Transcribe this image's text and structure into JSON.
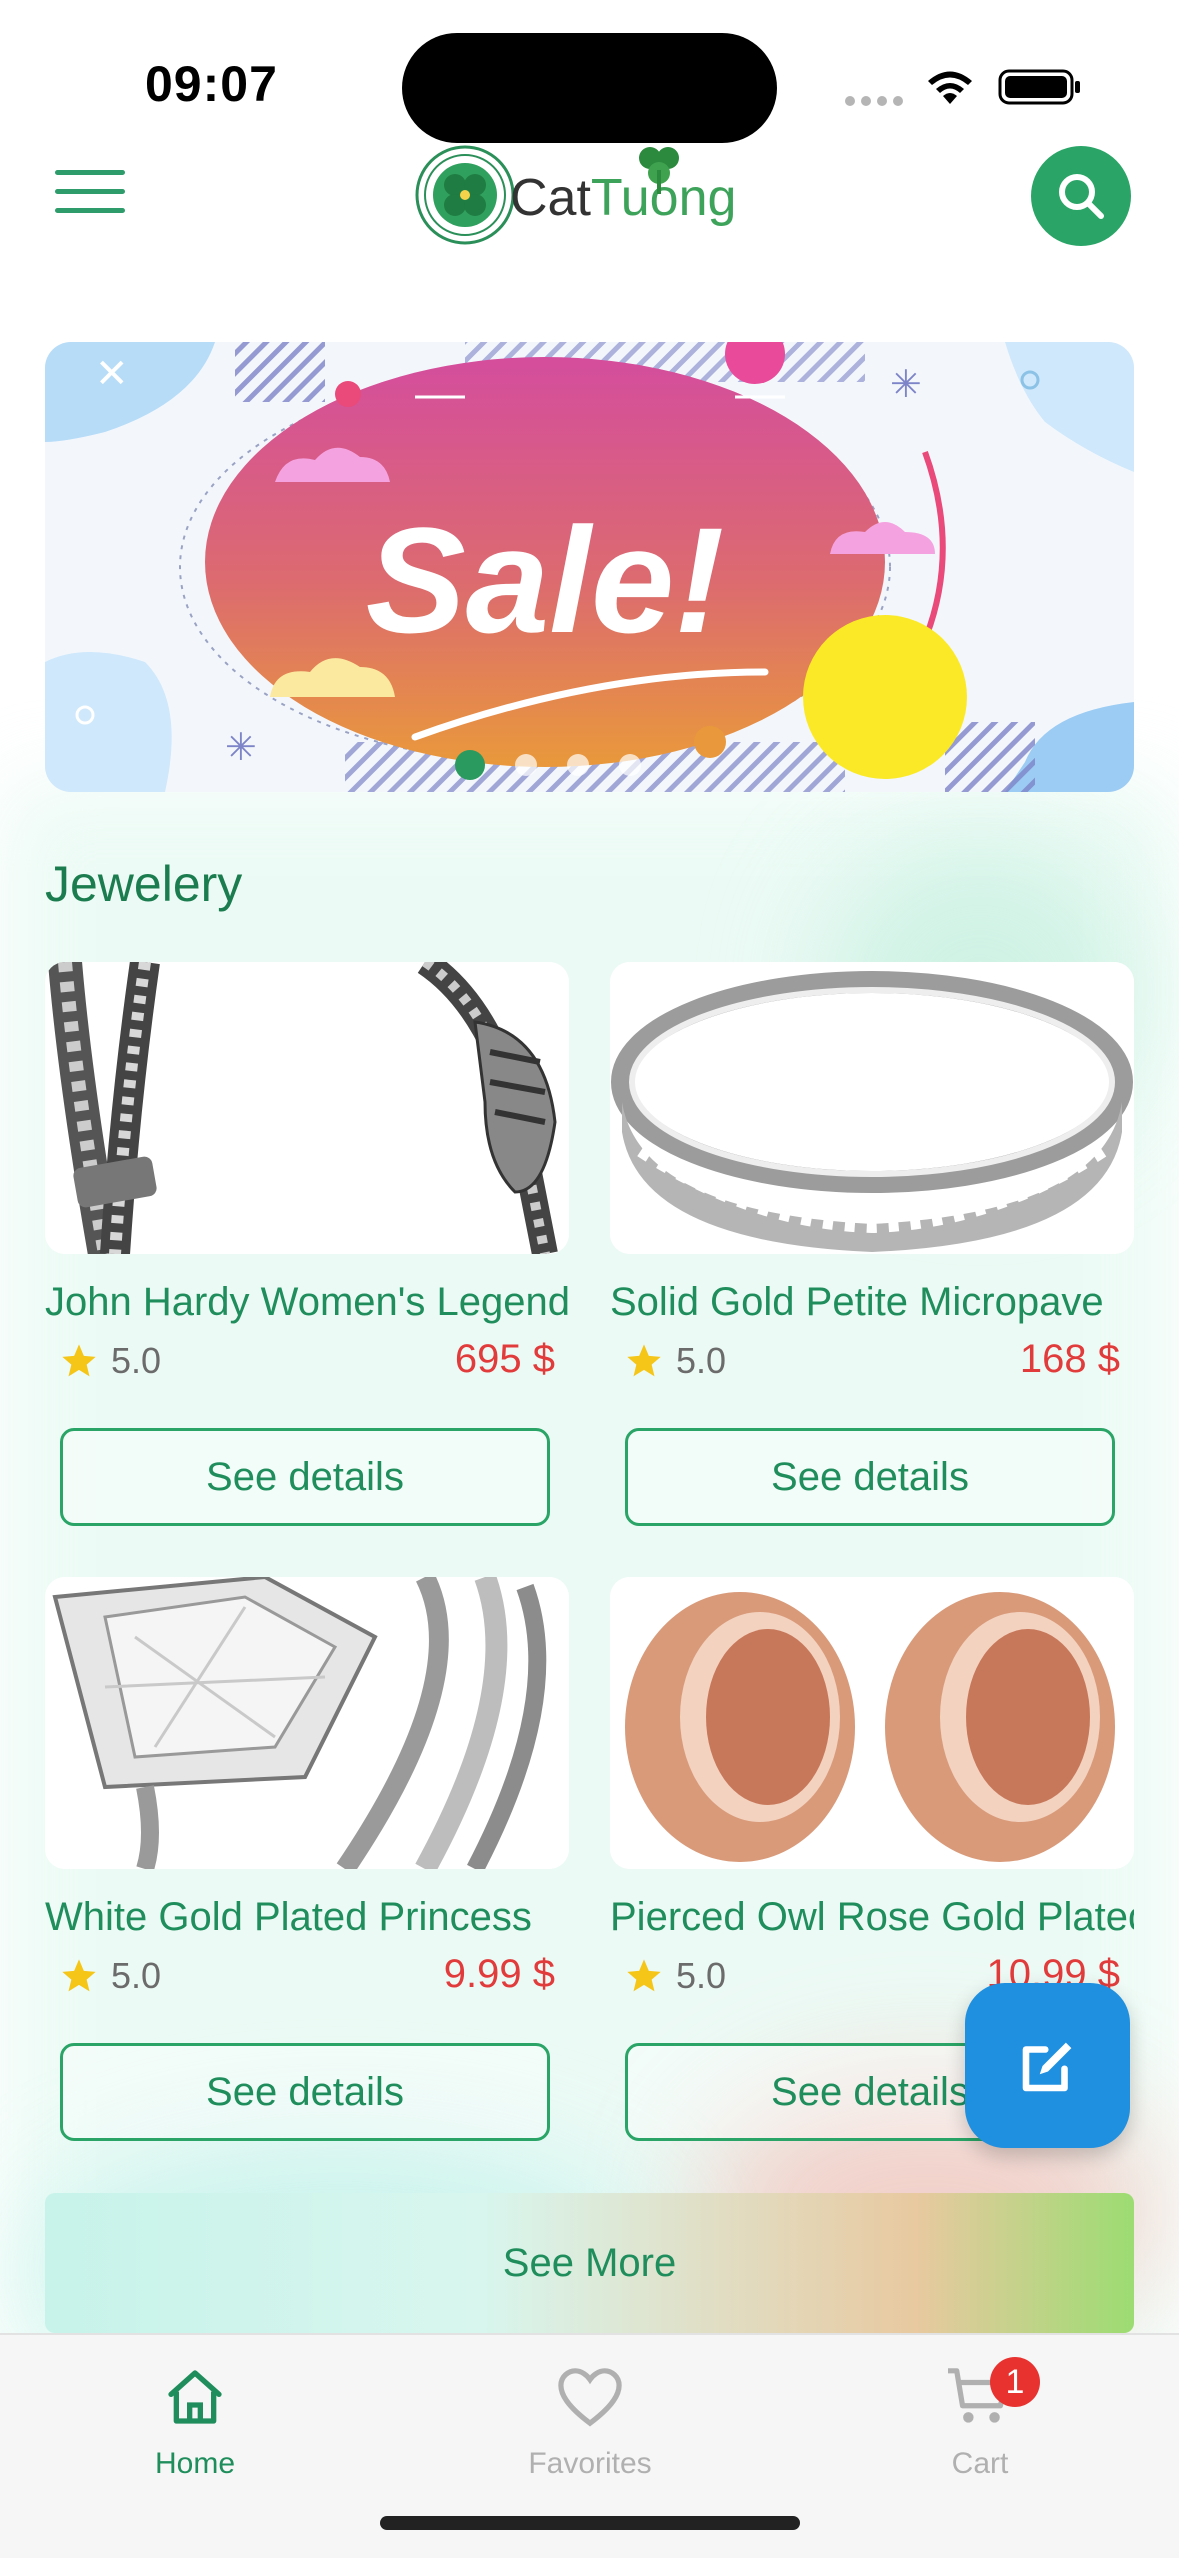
{
  "status_bar": {
    "time": "09:07"
  },
  "header": {
    "logo_text_1": "Cat",
    "logo_text_2": "Tuong"
  },
  "banner": {
    "headline": "Sale!",
    "pages": 5,
    "active_page": 1
  },
  "section": {
    "title": "Jewelery"
  },
  "products": [
    {
      "name": "John Hardy Women's Legends Naga",
      "rating": "5.0",
      "price": "695 $",
      "button": "See details"
    },
    {
      "name": "Solid Gold Petite Micropave",
      "rating": "5.0",
      "price": "168 $",
      "button": "See details"
    },
    {
      "name": "White Gold Plated Princess",
      "rating": "5.0",
      "price": "9.99 $",
      "button": "See details"
    },
    {
      "name": "Pierced Owl Rose Gold Plated",
      "rating": "5.0",
      "price": "10.99 $",
      "button": "See details"
    }
  ],
  "see_more": {
    "label": "See More"
  },
  "tabbar": {
    "home": "Home",
    "favorites": "Favorites",
    "cart": "Cart",
    "cart_badge": "1"
  },
  "colors": {
    "primary": "#2aa567",
    "price": "#e23b3b",
    "fab": "#1f8fe0"
  }
}
